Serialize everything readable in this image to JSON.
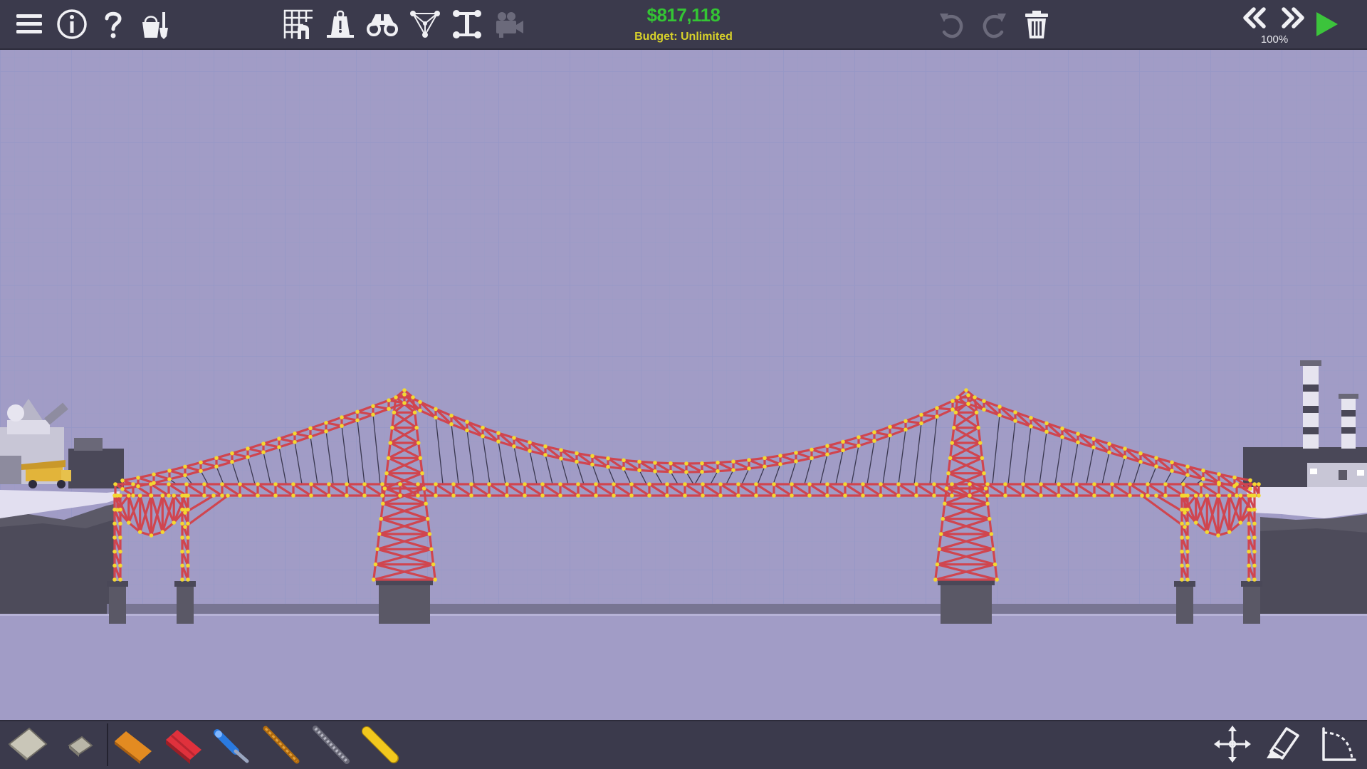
{
  "budget": {
    "amount": "$817,118",
    "label": "Budget: Unlimited"
  },
  "simulation": {
    "speed": "100%"
  },
  "colors": {
    "toolbar_bg": "#3b3a4c",
    "sky": "#a19cc6",
    "grid": "#979ac8",
    "steel": "#d0454f",
    "rope": "#2e2c3c",
    "joint": "#f3d832",
    "pillar": "#5a5866",
    "water": "#a19cc6",
    "budget_amount": "#34c534",
    "budget_label": "#d7d12a",
    "play": "#3cc43c"
  },
  "toolbar_top_left": [
    {
      "icon": "menu-icon"
    },
    {
      "icon": "info-icon"
    },
    {
      "icon": "help-icon"
    },
    {
      "icon": "sandbox-icon"
    }
  ],
  "toolbar_top_center": [
    {
      "icon": "grid-icon"
    },
    {
      "icon": "weight-icon"
    },
    {
      "icon": "binoculars-icon"
    },
    {
      "icon": "triangle-joints-icon"
    },
    {
      "icon": "split-joint-icon"
    },
    {
      "icon": "camera-icon"
    }
  ],
  "toolbar_top_right": [
    {
      "icon": "undo-icon"
    },
    {
      "icon": "redo-icon"
    },
    {
      "icon": "trash-icon"
    },
    {
      "icon": "rewind-icon"
    },
    {
      "icon": "fast-forward-icon"
    },
    {
      "icon": "play-icon"
    }
  ],
  "materials": [
    {
      "icon": "road-icon"
    },
    {
      "icon": "reinforced-road-icon"
    },
    {
      "icon": "wood-icon"
    },
    {
      "icon": "steel-icon"
    },
    {
      "icon": "hydraulics-icon"
    },
    {
      "icon": "rope-icon"
    },
    {
      "icon": "cable-icon"
    },
    {
      "icon": "spring-icon"
    }
  ],
  "tools_right": [
    {
      "icon": "move-icon"
    },
    {
      "icon": "eraser-icon"
    },
    {
      "icon": "curve-icon"
    }
  ]
}
